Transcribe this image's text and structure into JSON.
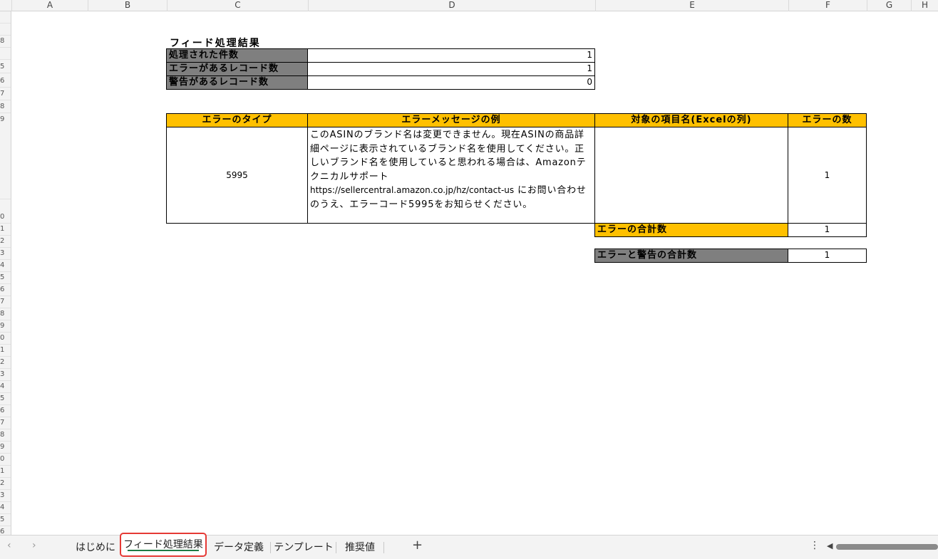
{
  "columns": [
    "A",
    "B",
    "C",
    "D",
    "E",
    "F",
    "G",
    "H"
  ],
  "rows": [
    "",
    "",
    "8",
    "",
    "5",
    "6",
    "7",
    "8",
    "9",
    "",
    "",
    "",
    "",
    "",
    "",
    "",
    "",
    "0",
    "1",
    "2",
    "3",
    "4",
    "5",
    "6",
    "7",
    "8",
    "9",
    "0",
    "1",
    "2",
    "3",
    "4",
    "5",
    "6",
    "7",
    "8",
    "9",
    "0",
    "1",
    "2",
    "3",
    "4",
    "5",
    "6"
  ],
  "summary": {
    "title": "フィード処理結果",
    "processed_label": "処理された件数",
    "processed_value": "1",
    "error_records_label": "エラーがあるレコード数",
    "error_records_value": "1",
    "warning_records_label": "警告があるレコード数",
    "warning_records_value": "0"
  },
  "error_table": {
    "headers": {
      "type": "エラーのタイプ",
      "message": "エラーメッセージの例",
      "field": "対象の項目名(Excelの列)",
      "count": "エラーの数"
    },
    "row": {
      "type": "5995",
      "message_part1": "このASINのブランド名は変更できません。現在ASINの商品詳細ページに表示されているブランド名を使用してください。正しいブランド名を使用していると思われる場合は、Amazonテクニカルサポート",
      "message_url": "https://sellercentral.amazon.co.jp/hz/contact-us",
      "message_part2": "にお問い合わせのうえ、エラーコード5995をお知らせください。",
      "field": "",
      "count": "1"
    },
    "total_errors_label": "エラーの合計数",
    "total_errors_value": "1",
    "total_all_label": "エラーと警告の合計数",
    "total_all_value": "1"
  },
  "tabs": {
    "intro": "はじめに",
    "results": "フィード処理結果",
    "definitions": "データ定義",
    "template": "テンプレート",
    "recommended": "推奨値",
    "add": "+",
    "prev": "‹",
    "next": "›",
    "more": "⋮",
    "scroll_left": "◀"
  },
  "colors": {
    "header_gray": "#7f7f7f",
    "header_gold": "#ffc000",
    "active_tab_outline": "#e53935",
    "active_tab_underline": "#1e7b45"
  }
}
